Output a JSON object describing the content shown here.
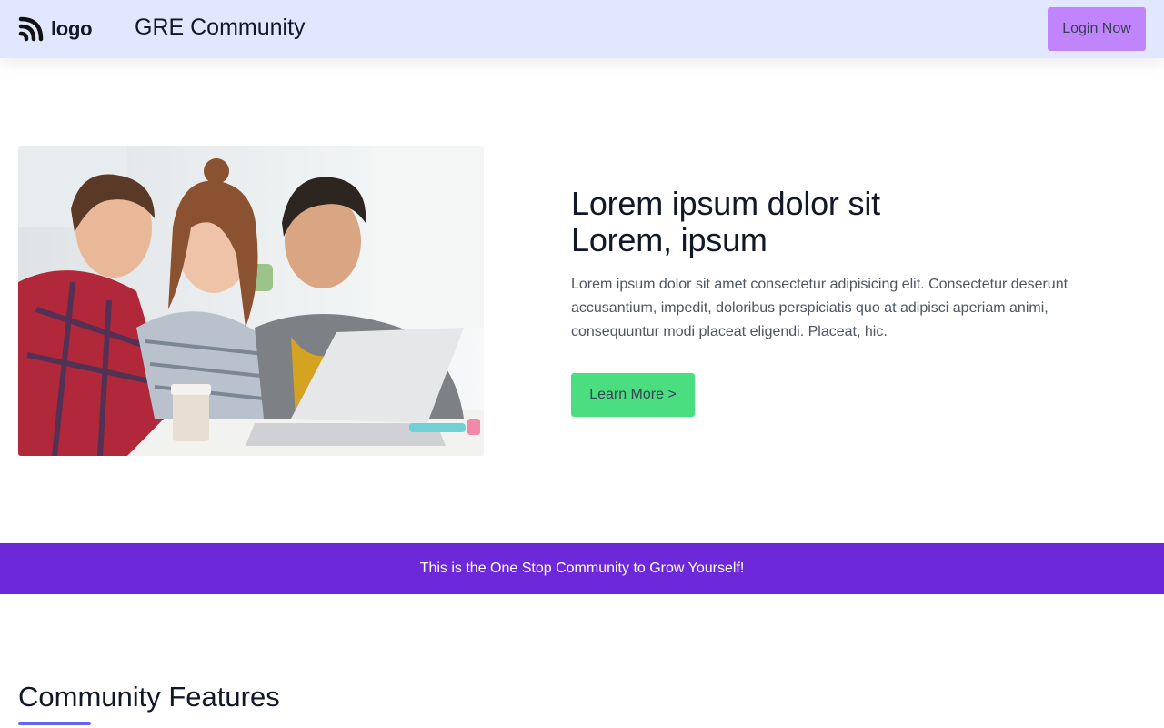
{
  "header": {
    "logo_text": "logo",
    "site_title": "GRE Community",
    "login_label": "Login Now"
  },
  "hero": {
    "title_line1": "Lorem ipsum dolor sit",
    "title_line2": "Lorem, ipsum",
    "description": "Lorem ipsum dolor sit amet consectetur adipisicing elit. Consectetur deserunt accusantium, impedit, doloribus perspiciatis quo at adipisci aperiam animi, consequuntur modi placeat eligendi. Placeat, hic.",
    "learn_more_label": "Learn More >"
  },
  "banner": {
    "text": "This is the One Stop Community to Grow Yourself!"
  },
  "features": {
    "title": "Community Features"
  },
  "icons": {
    "logo": "rss-feed-icon"
  },
  "colors": {
    "header_bg": "#e0e7ff",
    "login_button": "#c084fc",
    "learn_more_button": "#4ade80",
    "banner_bg": "#6d28d9",
    "underline_accent": "#6366f1"
  }
}
